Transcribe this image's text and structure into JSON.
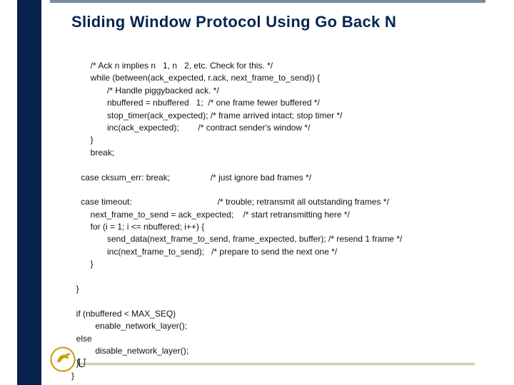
{
  "title": "Sliding Window Protocol Using Go Back N",
  "code": "        /* Ack n implies n   1, n   2, etc. Check for this. */\n        while (between(ack_expected, r.ack, next_frame_to_send)) {\n               /* Handle piggybacked ack. */\n               nbuffered = nbuffered   1;  /* one frame fewer buffered */\n               stop_timer(ack_expected); /* frame arrived intact; stop timer */\n               inc(ack_expected);        /* contract sender's window */\n        }\n        break;\n\n    case cksum_err: break;                 /* just ignore bad frames */\n\n    case timeout:                                    /* trouble; retransmit all outstanding frames */\n        next_frame_to_send = ack_expected;    /* start retransmitting here */\n        for (i = 1; i <= nbuffered; i++) {\n               send_data(next_frame_to_send, frame_expected, buffer); /* resend 1 frame */\n               inc(next_frame_to_send);   /* prepare to send the next one */\n        }\n\n  }\n\n  if (nbuffered < MAX_SEQ)\n          enable_network_layer();\n  else\n          disable_network_layer();\n  }\n}",
  "footer_letter": "U"
}
